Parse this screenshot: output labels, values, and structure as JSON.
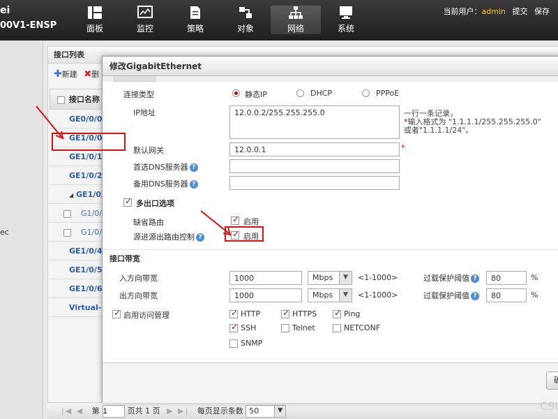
{
  "brand": {
    "line1": "ei",
    "line2": "00V1-ENSP"
  },
  "nav": [
    {
      "label": "面板",
      "icon": "dashboard-icon"
    },
    {
      "label": "监控",
      "icon": "monitor-icon"
    },
    {
      "label": "策略",
      "icon": "policy-icon"
    },
    {
      "label": "对象",
      "icon": "object-icon"
    },
    {
      "label": "网络",
      "icon": "network-icon"
    },
    {
      "label": "系统",
      "icon": "system-icon"
    }
  ],
  "user": {
    "prefix": "当前用户：",
    "name": "admin",
    "submit": "提交",
    "save": "保存"
  },
  "leftpane": {
    "text": "ec"
  },
  "list": {
    "title": "接口列表",
    "new_label": "新建",
    "delete_label": "删",
    "header": "接口名称",
    "rows": [
      {
        "label": "GE0/0/0("
      },
      {
        "label": "GE1/0/0("
      },
      {
        "label": "GE1/0/1("
      },
      {
        "label": "GE1/0/2("
      },
      {
        "label": "GE1/0/"
      },
      {
        "label": "G1/0/1"
      },
      {
        "label": "G1/0/1"
      },
      {
        "label": "GE1/0/4"
      },
      {
        "label": "GE1/0/5"
      },
      {
        "label": "GE1/0/6"
      },
      {
        "label": "Virtual-if"
      }
    ]
  },
  "pager": {
    "page_prefix": "第",
    "page_value": "1",
    "total": "页共 1 页",
    "per_page_label": "每页显示条数",
    "per_page": "50"
  },
  "modal": {
    "title": "修改GigabitEthernet",
    "conn_type_label": "连接类型",
    "conn_options": [
      "静态IP",
      "DHCP",
      "PPPoE"
    ],
    "ip_label": "IP地址",
    "ip_value": "12.0.0.2/255.255.255.0",
    "ip_hint": [
      "一行一条记录，",
      "输入格式为 \"1.1.1.1/255.255.255.0\"",
      "或者\"1.1.1.1/24\"。"
    ],
    "gateway_label": "默认网关",
    "gateway_value": "12.0.0.1",
    "dns1_label": "首选DNS服务器",
    "dns2_label": "备用DNS服务器",
    "multi_exit_label": "多出口选项",
    "default_route_label": "缺省路由",
    "enable_label": "启用",
    "src_route_label": "源进源出路由控制",
    "bandwidth_section": "接口带宽",
    "in_bw_label": "入方向带宽",
    "out_bw_label": "出方向带宽",
    "bw_value": "1000",
    "bw_unit": "Mbps",
    "bw_range": "<1-1000>",
    "overload_label": "过载保护阈值",
    "overload_value": "80",
    "percent": "%",
    "access_mgmt_label": "启用访问管理",
    "protocols": [
      "HTTP",
      "HTTPS",
      "Ping",
      "SSH",
      "Telnet",
      "NETCONF",
      "SNMP"
    ],
    "ok_label": "确"
  },
  "watermark": "CSI"
}
